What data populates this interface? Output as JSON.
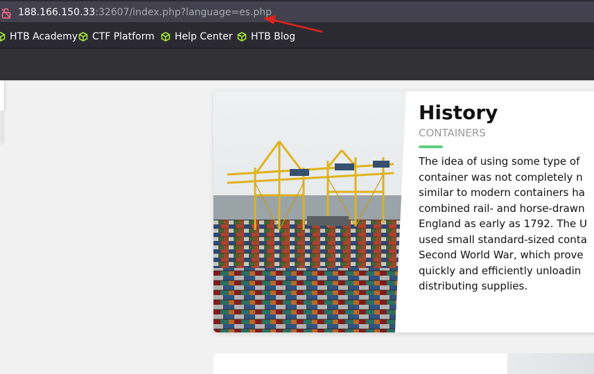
{
  "address_bar": {
    "url_host": "188.166.150.33",
    "url_rest": ":32607/index.php?language=es.php",
    "lock_icon": "insecure-lock-icon"
  },
  "bookmarks": [
    {
      "label": "HTB Academy",
      "icon": "cube-icon"
    },
    {
      "label": "CTF Platform",
      "icon": "cube-icon"
    },
    {
      "label": "Help Center",
      "icon": "cube-icon"
    },
    {
      "label": "HTB Blog",
      "icon": "cube-icon"
    }
  ],
  "card": {
    "title": "History",
    "subtitle": "CONTAINERS",
    "text_lines": [
      "The idea of using some type of",
      "container was not completely n",
      "similar to modern containers ha",
      "combined rail- and horse-drawn",
      "England as early as 1792. The U",
      "used small standard-sized conta",
      "Second World War, which prove",
      "quickly and efficiently unloadin",
      "distributing supplies."
    ]
  },
  "colors": {
    "browser_chrome": "#2b2a33",
    "url_field": "#42414d",
    "accent_green": "#5cd07e",
    "bookmark_icon": "#a4e534",
    "annotation_arrow": "#e0231c"
  }
}
